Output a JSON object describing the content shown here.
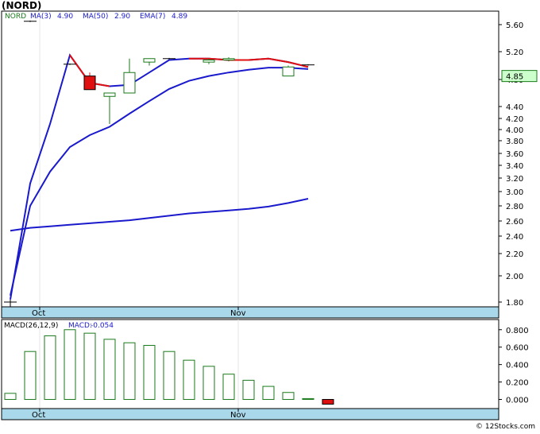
{
  "title": "(NORD)",
  "footer": "© 12Stocks.com",
  "colors": {
    "ma_line": "#1a1acc",
    "ema_line": "#e01010",
    "up_candle": "#1a7a1a",
    "down_candle": "#e01010",
    "axis_band": "#a8d8ea",
    "last_price_box": "#ccffcc",
    "grid": "#e0e0e0"
  },
  "chart_data": [
    {
      "type": "line",
      "panel": "price",
      "legend": [
        {
          "label": "NORD",
          "color": "#1a7a1a"
        },
        {
          "label": "MA(3)",
          "value": "4.90",
          "color": "#1a1acc"
        },
        {
          "label": "MA(50)",
          "value": "2.90",
          "color": "#1a1acc"
        },
        {
          "label": "EMA(7)",
          "value": "4.89",
          "color": "#1a1acc"
        }
      ],
      "x_labels": [
        {
          "label": "Oct",
          "index": 1
        },
        {
          "label": "Nov",
          "index": 11
        }
      ],
      "y_ticks": [
        "5.60",
        "5.20",
        "4.80",
        "4.40",
        "4.20",
        "4.00",
        "3.80",
        "3.60",
        "3.40",
        "3.20",
        "3.00",
        "2.80",
        "2.60",
        "2.40",
        "2.20",
        "2.00",
        "1.80"
      ],
      "ylim": [
        1.72,
        5.78
      ],
      "last_price": "4.85",
      "candles": [
        {
          "o": 1.8,
          "h": 1.82,
          "l": 1.75,
          "c": 1.8,
          "color": "#000000"
        },
        {
          "o": 5.65,
          "h": 5.66,
          "l": 5.64,
          "c": 5.65,
          "color": "#000000"
        },
        {
          "o": null,
          "h": null,
          "l": null,
          "c": null,
          "color": null
        },
        {
          "o": 5.02,
          "h": 5.03,
          "l": 5.01,
          "c": 5.02,
          "color": "#000000"
        },
        {
          "o": 4.85,
          "h": 4.9,
          "l": 4.65,
          "c": 4.65,
          "color": "#e01010"
        },
        {
          "o": 4.55,
          "h": 4.6,
          "l": 4.1,
          "c": 4.6,
          "color": "#1a7a1a"
        },
        {
          "o": 4.6,
          "h": 5.1,
          "l": 4.6,
          "c": 4.9,
          "color": "#1a7a1a"
        },
        {
          "o": 5.05,
          "h": 5.1,
          "l": 5.0,
          "c": 5.1,
          "color": "#1a7a1a"
        },
        {
          "o": 5.1,
          "h": 5.11,
          "l": 5.09,
          "c": 5.1,
          "color": "#000000"
        },
        {
          "o": null,
          "h": null,
          "l": null,
          "c": null,
          "color": null
        },
        {
          "o": 5.05,
          "h": 5.1,
          "l": 5.02,
          "c": 5.08,
          "color": "#1a7a1a"
        },
        {
          "o": 5.08,
          "h": 5.12,
          "l": 5.06,
          "c": 5.1,
          "color": "#1a7a1a"
        },
        {
          "o": null,
          "h": null,
          "l": null,
          "c": null,
          "color": null
        },
        {
          "o": null,
          "h": null,
          "l": null,
          "c": null,
          "color": null
        },
        {
          "o": 4.85,
          "h": 5.0,
          "l": 4.85,
          "c": 4.98,
          "color": "#1a7a1a"
        },
        {
          "o": 5.01,
          "h": 5.02,
          "l": 5.0,
          "c": 5.01,
          "color": "#000000"
        }
      ],
      "series": [
        {
          "name": "MA(3)",
          "color": "#1a1acc",
          "points": [
            [
              0,
              1.82
            ],
            [
              1,
              3.12
            ],
            [
              2,
              4.1
            ],
            [
              3,
              5.15
            ],
            [
              4,
              4.75
            ],
            [
              5,
              4.7
            ],
            [
              6,
              4.72
            ],
            [
              7,
              4.9
            ],
            [
              8,
              5.08
            ],
            [
              9,
              5.1
            ],
            [
              10,
              5.1
            ],
            [
              11,
              5.08
            ],
            [
              12,
              5.08
            ],
            [
              13,
              5.1
            ],
            [
              14,
              5.05
            ],
            [
              15,
              4.98
            ]
          ]
        },
        {
          "name": "EMA(7)",
          "color": "#1a1acc",
          "points": [
            [
              0,
              1.85
            ],
            [
              1,
              2.8
            ],
            [
              2,
              3.3
            ],
            [
              3,
              3.7
            ],
            [
              4,
              3.9
            ],
            [
              5,
              4.05
            ],
            [
              6,
              4.28
            ],
            [
              7,
              4.48
            ],
            [
              8,
              4.66
            ],
            [
              9,
              4.78
            ],
            [
              10,
              4.85
            ],
            [
              11,
              4.9
            ],
            [
              12,
              4.94
            ],
            [
              13,
              4.97
            ],
            [
              14,
              4.97
            ],
            [
              15,
              4.95
            ]
          ]
        },
        {
          "name": "MA(50)",
          "color": "#1a1acc",
          "points": [
            [
              0,
              2.47
            ],
            [
              1,
              2.51
            ],
            [
              2,
              2.53
            ],
            [
              3,
              2.55
            ],
            [
              4,
              2.57
            ],
            [
              5,
              2.59
            ],
            [
              6,
              2.61
            ],
            [
              7,
              2.64
            ],
            [
              8,
              2.67
            ],
            [
              9,
              2.7
            ],
            [
              10,
              2.72
            ],
            [
              11,
              2.74
            ],
            [
              12,
              2.76
            ],
            [
              13,
              2.79
            ],
            [
              14,
              2.84
            ],
            [
              15,
              2.9
            ]
          ]
        },
        {
          "name": "EMA(7) recent",
          "color": "#e01010",
          "points": [
            [
              3,
              5.15
            ],
            [
              4,
              4.75
            ],
            [
              5,
              4.7
            ],
            [
              6,
              4.72
            ],
            [
              7,
              4.9
            ],
            [
              8,
              5.08
            ],
            [
              9,
              5.1
            ],
            [
              10,
              5.1
            ],
            [
              11,
              5.08
            ],
            [
              12,
              5.08
            ],
            [
              13,
              5.1
            ],
            [
              14,
              5.05
            ],
            [
              15,
              4.98
            ]
          ],
          "segments_red": [
            [
              3,
              4
            ],
            [
              4,
              5
            ],
            [
              12,
              13
            ],
            [
              13,
              14
            ],
            [
              14,
              15
            ],
            [
              10,
              11
            ],
            [
              11,
              12
            ],
            [
              9,
              10
            ]
          ]
        }
      ]
    },
    {
      "type": "bar",
      "panel": "macd",
      "label": "MACD(26,12,9)",
      "value_label": "MACD:",
      "value": "-0.054",
      "x_labels": [
        {
          "label": "Oct",
          "index": 1
        },
        {
          "label": "Nov",
          "index": 11
        }
      ],
      "y_ticks": [
        "0.800",
        "0.600",
        "0.400",
        "0.200",
        "0.000"
      ],
      "ylim": [
        -0.05,
        0.88
      ],
      "values": [
        0.07,
        0.55,
        0.73,
        0.8,
        0.76,
        0.69,
        0.65,
        0.62,
        0.55,
        0.45,
        0.38,
        0.29,
        0.22,
        0.15,
        0.08,
        0.01,
        -0.054
      ]
    }
  ]
}
